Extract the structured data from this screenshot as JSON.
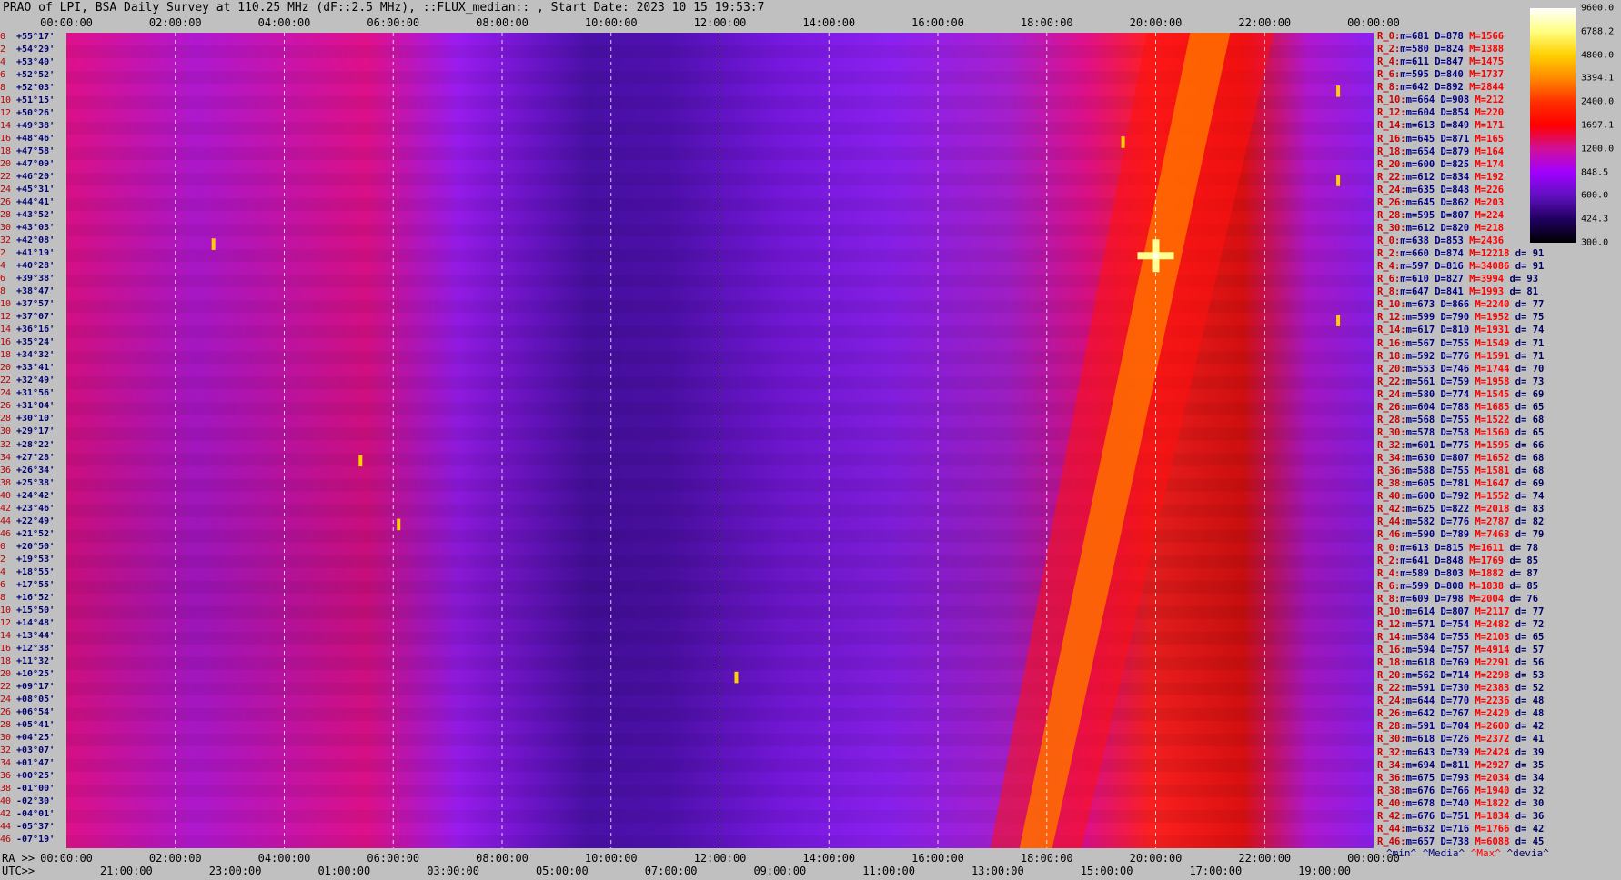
{
  "chart_data": {
    "type": "heatmap",
    "title": "PRAO of LPI, BSA Daily Survey at 110.25 MHz (dF::2.5 MHz), ::FLUX_median:: , Start Date: 2023 10 15 19:53:7",
    "top_ticks": [
      "00:00:00",
      "02:00:00",
      "04:00:00",
      "06:00:00",
      "08:00:00",
      "10:00:00",
      "12:00:00",
      "14:00:00",
      "16:00:00",
      "18:00:00",
      "20:00:00",
      "22:00:00",
      "00:00:00"
    ],
    "top_tick_hours": [
      0,
      2,
      4,
      6,
      8,
      10,
      12,
      14,
      16,
      18,
      20,
      22,
      24
    ],
    "ra_prefix": "RA >>",
    "ra_ticks": [
      "00:00:00",
      "02:00:00",
      "04:00:00",
      "06:00:00",
      "08:00:00",
      "10:00:00",
      "12:00:00",
      "14:00:00",
      "16:00:00",
      "18:00:00",
      "20:00:00",
      "22:00:00",
      "00:00:00"
    ],
    "utc_prefix": "UTC>>",
    "utc_ticks": [
      "21:00:00",
      "23:00:00",
      "01:00:00",
      "03:00:00",
      "05:00:00",
      "07:00:00",
      "09:00:00",
      "11:00:00",
      "13:00:00",
      "15:00:00",
      "17:00:00",
      "19:00:00"
    ],
    "utc_tick_hours": [
      1.1,
      3.1,
      5.1,
      7.1,
      9.1,
      11.1,
      13.1,
      15.1,
      17.1,
      19.1,
      21.1,
      23.1
    ],
    "declinations": [
      {
        "i": "0",
        "d": "+55°17'"
      },
      {
        "i": "2",
        "d": "+54°29'"
      },
      {
        "i": "4",
        "d": "+53°40'"
      },
      {
        "i": "6",
        "d": "+52°52'"
      },
      {
        "i": "8",
        "d": "+52°03'"
      },
      {
        "i": "10",
        "d": "+51°15'"
      },
      {
        "i": "12",
        "d": "+50°26'"
      },
      {
        "i": "14",
        "d": "+49°38'"
      },
      {
        "i": "16",
        "d": "+48°46'"
      },
      {
        "i": "18",
        "d": "+47°58'"
      },
      {
        "i": "20",
        "d": "+47°09'"
      },
      {
        "i": "22",
        "d": "+46°20'"
      },
      {
        "i": "24",
        "d": "+45°31'"
      },
      {
        "i": "26",
        "d": "+44°41'"
      },
      {
        "i": "28",
        "d": "+43°52'"
      },
      {
        "i": "30",
        "d": "+43°03'"
      },
      {
        "i": "32",
        "d": "+42°08'"
      },
      {
        "i": "2",
        "d": "+41°19'"
      },
      {
        "i": "4",
        "d": "+40°28'"
      },
      {
        "i": "6",
        "d": "+39°38'"
      },
      {
        "i": "8",
        "d": "+38°47'"
      },
      {
        "i": "10",
        "d": "+37°57'"
      },
      {
        "i": "12",
        "d": "+37°07'"
      },
      {
        "i": "14",
        "d": "+36°16'"
      },
      {
        "i": "16",
        "d": "+35°24'"
      },
      {
        "i": "18",
        "d": "+34°32'"
      },
      {
        "i": "20",
        "d": "+33°41'"
      },
      {
        "i": "22",
        "d": "+32°49'"
      },
      {
        "i": "24",
        "d": "+31°56'"
      },
      {
        "i": "26",
        "d": "+31°04'"
      },
      {
        "i": "28",
        "d": "+30°10'"
      },
      {
        "i": "30",
        "d": "+29°17'"
      },
      {
        "i": "32",
        "d": "+28°22'"
      },
      {
        "i": "34",
        "d": "+27°28'"
      },
      {
        "i": "36",
        "d": "+26°34'"
      },
      {
        "i": "38",
        "d": "+25°38'"
      },
      {
        "i": "40",
        "d": "+24°42'"
      },
      {
        "i": "42",
        "d": "+23°46'"
      },
      {
        "i": "44",
        "d": "+22°49'"
      },
      {
        "i": "46",
        "d": "+21°52'"
      },
      {
        "i": "0",
        "d": "+20°50'"
      },
      {
        "i": "2",
        "d": "+19°53'"
      },
      {
        "i": "4",
        "d": "+18°55'"
      },
      {
        "i": "6",
        "d": "+17°55'"
      },
      {
        "i": "8",
        "d": "+16°52'"
      },
      {
        "i": "10",
        "d": "+15°50'"
      },
      {
        "i": "12",
        "d": "+14°48'"
      },
      {
        "i": "14",
        "d": "+13°44'"
      },
      {
        "i": "16",
        "d": "+12°38'"
      },
      {
        "i": "18",
        "d": "+11°32'"
      },
      {
        "i": "20",
        "d": "+10°25'"
      },
      {
        "i": "22",
        "d": "+09°17'"
      },
      {
        "i": "24",
        "d": "+08°05'"
      },
      {
        "i": "26",
        "d": "+06°54'"
      },
      {
        "i": "28",
        "d": "+05°41'"
      },
      {
        "i": "30",
        "d": "+04°25'"
      },
      {
        "i": "32",
        "d": "+03°07'"
      },
      {
        "i": "34",
        "d": "+01°47'"
      },
      {
        "i": "36",
        "d": "+00°25'"
      },
      {
        "i": "38",
        "d": "-01°00'"
      },
      {
        "i": "40",
        "d": "-02°30'"
      },
      {
        "i": "42",
        "d": "-04°01'"
      },
      {
        "i": "44",
        "d": "-05°37'"
      },
      {
        "i": "46",
        "d": "-07°19'"
      }
    ],
    "stats": [
      {
        "r": "R_0:",
        "m": "681",
        "D": "878",
        "M": "1566",
        "d": ""
      },
      {
        "r": "R_2:",
        "m": "580",
        "D": "824",
        "M": "1388",
        "d": ""
      },
      {
        "r": "R_4:",
        "m": "611",
        "D": "847",
        "M": "1475",
        "d": ""
      },
      {
        "r": "R_6:",
        "m": "595",
        "D": "840",
        "M": "1737",
        "d": ""
      },
      {
        "r": "R_8:",
        "m": "642",
        "D": "892",
        "M": "2844",
        "d": ""
      },
      {
        "r": "R_10:",
        "m": "664",
        "D": "908",
        "M": "212",
        "d": ""
      },
      {
        "r": "R_12:",
        "m": "604",
        "D": "854",
        "M": "220",
        "d": ""
      },
      {
        "r": "R_14:",
        "m": "613",
        "D": "849",
        "M": "171",
        "d": ""
      },
      {
        "r": "R_16:",
        "m": "645",
        "D": "871",
        "M": "165",
        "d": ""
      },
      {
        "r": "R_18:",
        "m": "654",
        "D": "879",
        "M": "164",
        "d": ""
      },
      {
        "r": "R_20:",
        "m": "600",
        "D": "825",
        "M": "174",
        "d": ""
      },
      {
        "r": "R_22:",
        "m": "612",
        "D": "834",
        "M": "192",
        "d": ""
      },
      {
        "r": "R_24:",
        "m": "635",
        "D": "848",
        "M": "226",
        "d": ""
      },
      {
        "r": "R_26:",
        "m": "645",
        "D": "862",
        "M": "203",
        "d": ""
      },
      {
        "r": "R_28:",
        "m": "595",
        "D": "807",
        "M": "224",
        "d": ""
      },
      {
        "r": "R_30:",
        "m": "612",
        "D": "820",
        "M": "218",
        "d": ""
      },
      {
        "r": "R_0:",
        "m": "638",
        "D": "853",
        "M": "2436",
        "d": ""
      },
      {
        "r": "R_2:",
        "m": "660",
        "D": "874",
        "M": "12218",
        "d": "91"
      },
      {
        "r": "R_4:",
        "m": "597",
        "D": "816",
        "M": "34086",
        "d": "91"
      },
      {
        "r": "R_6:",
        "m": "610",
        "D": "827",
        "M": "3994",
        "d": "93"
      },
      {
        "r": "R_8:",
        "m": "647",
        "D": "841",
        "M": "1993",
        "d": "81"
      },
      {
        "r": "R_10:",
        "m": "673",
        "D": "866",
        "M": "2240",
        "d": "77"
      },
      {
        "r": "R_12:",
        "m": "599",
        "D": "790",
        "M": "1952",
        "d": "75"
      },
      {
        "r": "R_14:",
        "m": "617",
        "D": "810",
        "M": "1931",
        "d": "74"
      },
      {
        "r": "R_16:",
        "m": "567",
        "D": "755",
        "M": "1549",
        "d": "71"
      },
      {
        "r": "R_18:",
        "m": "592",
        "D": "776",
        "M": "1591",
        "d": "71"
      },
      {
        "r": "R_20:",
        "m": "553",
        "D": "746",
        "M": "1744",
        "d": "70"
      },
      {
        "r": "R_22:",
        "m": "561",
        "D": "759",
        "M": "1958",
        "d": "73"
      },
      {
        "r": "R_24:",
        "m": "580",
        "D": "774",
        "M": "1545",
        "d": "69"
      },
      {
        "r": "R_26:",
        "m": "604",
        "D": "788",
        "M": "1685",
        "d": "65"
      },
      {
        "r": "R_28:",
        "m": "568",
        "D": "755",
        "M": "1522",
        "d": "68"
      },
      {
        "r": "R_30:",
        "m": "578",
        "D": "758",
        "M": "1560",
        "d": "65"
      },
      {
        "r": "R_32:",
        "m": "601",
        "D": "775",
        "M": "1595",
        "d": "66"
      },
      {
        "r": "R_34:",
        "m": "630",
        "D": "807",
        "M": "1652",
        "d": "68"
      },
      {
        "r": "R_36:",
        "m": "588",
        "D": "755",
        "M": "1581",
        "d": "68"
      },
      {
        "r": "R_38:",
        "m": "605",
        "D": "781",
        "M": "1647",
        "d": "69"
      },
      {
        "r": "R_40:",
        "m": "600",
        "D": "792",
        "M": "1552",
        "d": "74"
      },
      {
        "r": "R_42:",
        "m": "625",
        "D": "822",
        "M": "2018",
        "d": "83"
      },
      {
        "r": "R_44:",
        "m": "582",
        "D": "776",
        "M": "2787",
        "d": "82"
      },
      {
        "r": "R_46:",
        "m": "590",
        "D": "789",
        "M": "7463",
        "d": "79"
      },
      {
        "r": "R_0:",
        "m": "613",
        "D": "815",
        "M": "1611",
        "d": "78"
      },
      {
        "r": "R_2:",
        "m": "641",
        "D": "848",
        "M": "1769",
        "d": "85"
      },
      {
        "r": "R_4:",
        "m": "589",
        "D": "803",
        "M": "1882",
        "d": "87"
      },
      {
        "r": "R_6:",
        "m": "599",
        "D": "808",
        "M": "1838",
        "d": "85"
      },
      {
        "r": "R_8:",
        "m": "609",
        "D": "798",
        "M": "2004",
        "d": "76"
      },
      {
        "r": "R_10:",
        "m": "614",
        "D": "807",
        "M": "2117",
        "d": "77"
      },
      {
        "r": "R_12:",
        "m": "571",
        "D": "754",
        "M": "2482",
        "d": "72"
      },
      {
        "r": "R_14:",
        "m": "584",
        "D": "755",
        "M": "2103",
        "d": "65"
      },
      {
        "r": "R_16:",
        "m": "594",
        "D": "757",
        "M": "4914",
        "d": "57"
      },
      {
        "r": "R_18:",
        "m": "618",
        "D": "769",
        "M": "2291",
        "d": "56"
      },
      {
        "r": "R_20:",
        "m": "562",
        "D": "714",
        "M": "2298",
        "d": "53"
      },
      {
        "r": "R_22:",
        "m": "591",
        "D": "730",
        "M": "2383",
        "d": "52"
      },
      {
        "r": "R_24:",
        "m": "644",
        "D": "770",
        "M": "2236",
        "d": "48"
      },
      {
        "r": "R_26:",
        "m": "642",
        "D": "767",
        "M": "2420",
        "d": "48"
      },
      {
        "r": "R_28:",
        "m": "591",
        "D": "704",
        "M": "2600",
        "d": "42"
      },
      {
        "r": "R_30:",
        "m": "618",
        "D": "726",
        "M": "2372",
        "d": "41"
      },
      {
        "r": "R_32:",
        "m": "643",
        "D": "739",
        "M": "2424",
        "d": "39"
      },
      {
        "r": "R_34:",
        "m": "694",
        "D": "811",
        "M": "2927",
        "d": "35"
      },
      {
        "r": "R_36:",
        "m": "675",
        "D": "793",
        "M": "2034",
        "d": "34"
      },
      {
        "r": "R_38:",
        "m": "676",
        "D": "766",
        "M": "1940",
        "d": "32"
      },
      {
        "r": "R_40:",
        "m": "678",
        "D": "740",
        "M": "1822",
        "d": "30"
      },
      {
        "r": "R_42:",
        "m": "676",
        "D": "751",
        "M": "1834",
        "d": "36"
      },
      {
        "r": "R_44:",
        "m": "632",
        "D": "716",
        "M": "1766",
        "d": "42"
      },
      {
        "r": "R_46:",
        "m": "657",
        "D": "738",
        "M": "6088",
        "d": "45"
      }
    ],
    "stat_legend": {
      "min": "^min^",
      "median": "^Media^",
      "max": "^Max^",
      "devia": "^devia^"
    },
    "colorbar": {
      "labels": [
        "9600.0",
        "6788.2",
        "4800.0",
        "3394.1",
        "2400.0",
        "1697.1",
        "1200.0",
        "848.5",
        "600.0",
        "424.3",
        "300.0"
      ],
      "colors": [
        "#ffffff",
        "#ffff80",
        "#ffd000",
        "#ff8800",
        "#ff3000",
        "#ff0000",
        "#d0109a",
        "#a000ff",
        "#6010c0",
        "#200060",
        "#000000"
      ]
    },
    "features": {
      "sun_track": {
        "ra_hours_top": 21.0,
        "ra_hours_bottom": 17.8,
        "color": "#ff7000"
      },
      "bright_source_ra": 20.0,
      "bright_source_row": 17,
      "background_dip_ra": 9.5,
      "galactic_ridge_ra": 5.5,
      "colors": {
        "base": "#8c20f0",
        "dark": "#4a10a8",
        "warm": "#e0108a",
        "hot": "#ff2020",
        "peak": "#ffff90"
      }
    }
  }
}
